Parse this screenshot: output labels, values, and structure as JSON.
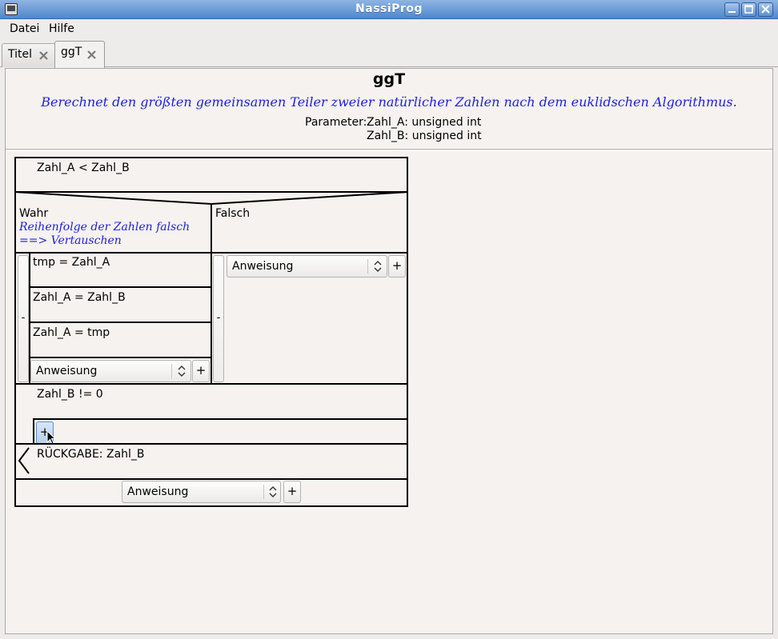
{
  "window": {
    "title": "NassiProg"
  },
  "menu": [
    {
      "label": "Datei"
    },
    {
      "label": "Hilfe"
    }
  ],
  "tabs": [
    {
      "label": "Titel"
    },
    {
      "label": "ggT"
    }
  ],
  "procedure": {
    "name": "ggT",
    "description": "Berechnet den größten gemeinsamen Teiler zweier natürlicher Zahlen nach dem euklidschen Algorithmus.",
    "params_label": "Parameter:",
    "params": [
      "Zahl_A: unsigned int",
      "Zahl_B: unsigned int"
    ]
  },
  "diagram": {
    "condition": "Zahl_A < Zahl_B",
    "true_label": "Wahr",
    "false_label": "Falsch",
    "true_comment": [
      "Reihenfolge der Zahlen falsch",
      "==> Vertauschen"
    ],
    "true_statements": [
      "tmp = Zahl_A",
      "Zahl_A = Zahl_B",
      "Zahl_A = tmp"
    ],
    "collapse_symbol": "-",
    "loop_condition": "Zahl_B != 0",
    "return_statement": "RÜCKGABE: Zahl_B",
    "combo_value": "Anweisung",
    "add_symbol": "+"
  }
}
